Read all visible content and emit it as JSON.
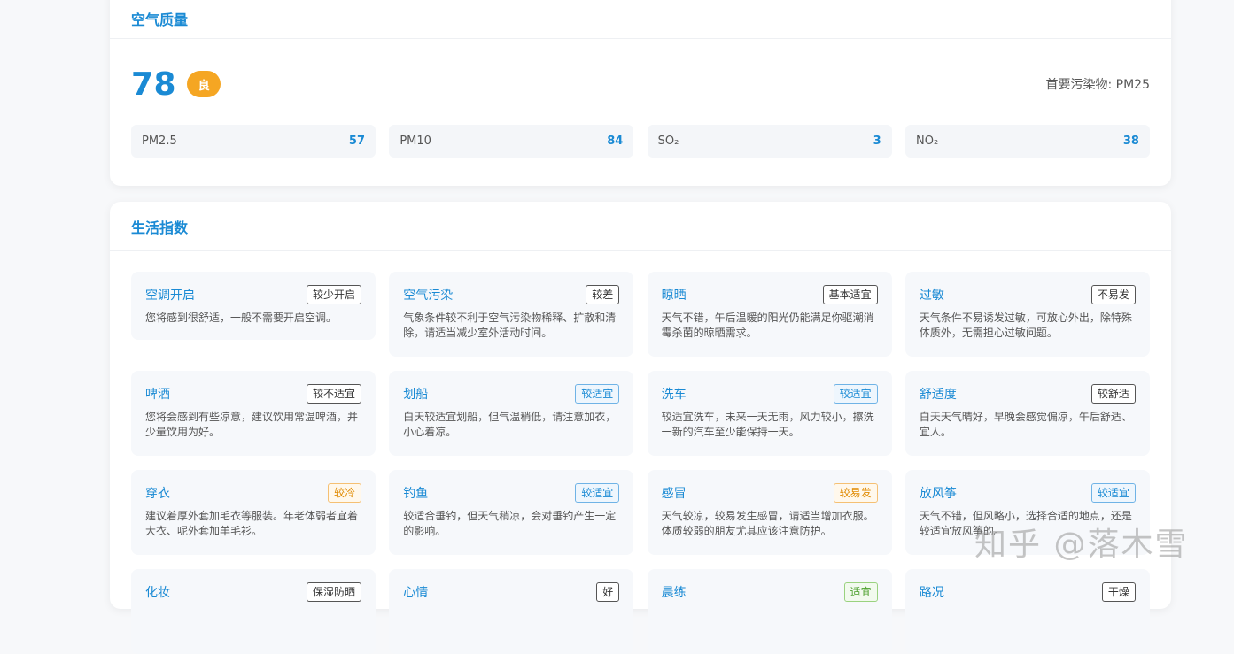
{
  "air_quality": {
    "title": "空气质量",
    "aqi": "78",
    "level": "良",
    "primary_pollutant": "首要污染物: PM25",
    "pollutants": [
      {
        "name": "PM2.5",
        "value": "57"
      },
      {
        "name": "PM10",
        "value": "84"
      },
      {
        "name": "SO₂",
        "value": "3"
      },
      {
        "name": "NO₂",
        "value": "38"
      }
    ],
    "colors": {
      "accent": "#1a8ad4",
      "level_badge": "#f5a623"
    }
  },
  "life": {
    "title": "生活指数",
    "items": [
      {
        "name": "空调开启",
        "badge": "较少开启",
        "desc": "您将感到很舒适，一般不需要开启空调。"
      },
      {
        "name": "空气污染",
        "badge": "较差",
        "desc": "气象条件较不利于空气污染物稀释、扩散和清除，请适当减少室外活动时间。"
      },
      {
        "name": "晾晒",
        "badge": "基本适宜",
        "desc": "天气不错，午后温暖的阳光仍能满足你驱潮消霉杀菌的晾晒需求。"
      },
      {
        "name": "过敏",
        "badge": "不易发",
        "desc": "天气条件不易诱发过敏，可放心外出，除特殊体质外，无需担心过敏问题。"
      },
      {
        "name": "啤酒",
        "badge": "较不适宜",
        "desc": "您将会感到有些凉意，建议饮用常温啤酒，并少量饮用为好。"
      },
      {
        "name": "划船",
        "badge": "较适宜",
        "desc": "白天较适宜划船，但气温稍低，请注意加衣，小心着凉。"
      },
      {
        "name": "洗车",
        "badge": "较适宜",
        "desc": "较适宜洗车，未来一天无雨，风力较小，擦洗一新的汽车至少能保持一天。"
      },
      {
        "name": "舒适度",
        "badge": "较舒适",
        "desc": "白天天气晴好，早晚会感觉偏凉，午后舒适、宜人。"
      },
      {
        "name": "穿衣",
        "badge": "较冷",
        "desc": "建议着厚外套加毛衣等服装。年老体弱者宜着大衣、呢外套加羊毛衫。"
      },
      {
        "name": "钓鱼",
        "badge": "较适宜",
        "desc": "较适合垂钓，但天气稍凉，会对垂钓产生一定的影响。"
      },
      {
        "name": "感冒",
        "badge": "较易发",
        "desc": "天气较凉，较易发生感冒，请适当增加衣服。体质较弱的朋友尤其应该注意防护。"
      },
      {
        "name": "放风筝",
        "badge": "较适宜",
        "desc": "天气不错，但风略小，选择合适的地点，还是较适宜放风筝的。"
      },
      {
        "name": "化妆",
        "badge": "保湿防晒",
        "desc": ""
      },
      {
        "name": "心情",
        "badge": "好",
        "desc": ""
      },
      {
        "name": "晨练",
        "badge": "适宜",
        "desc": ""
      },
      {
        "name": "路况",
        "badge": "干燥",
        "desc": ""
      }
    ]
  },
  "watermark": "知乎 @落木雪"
}
